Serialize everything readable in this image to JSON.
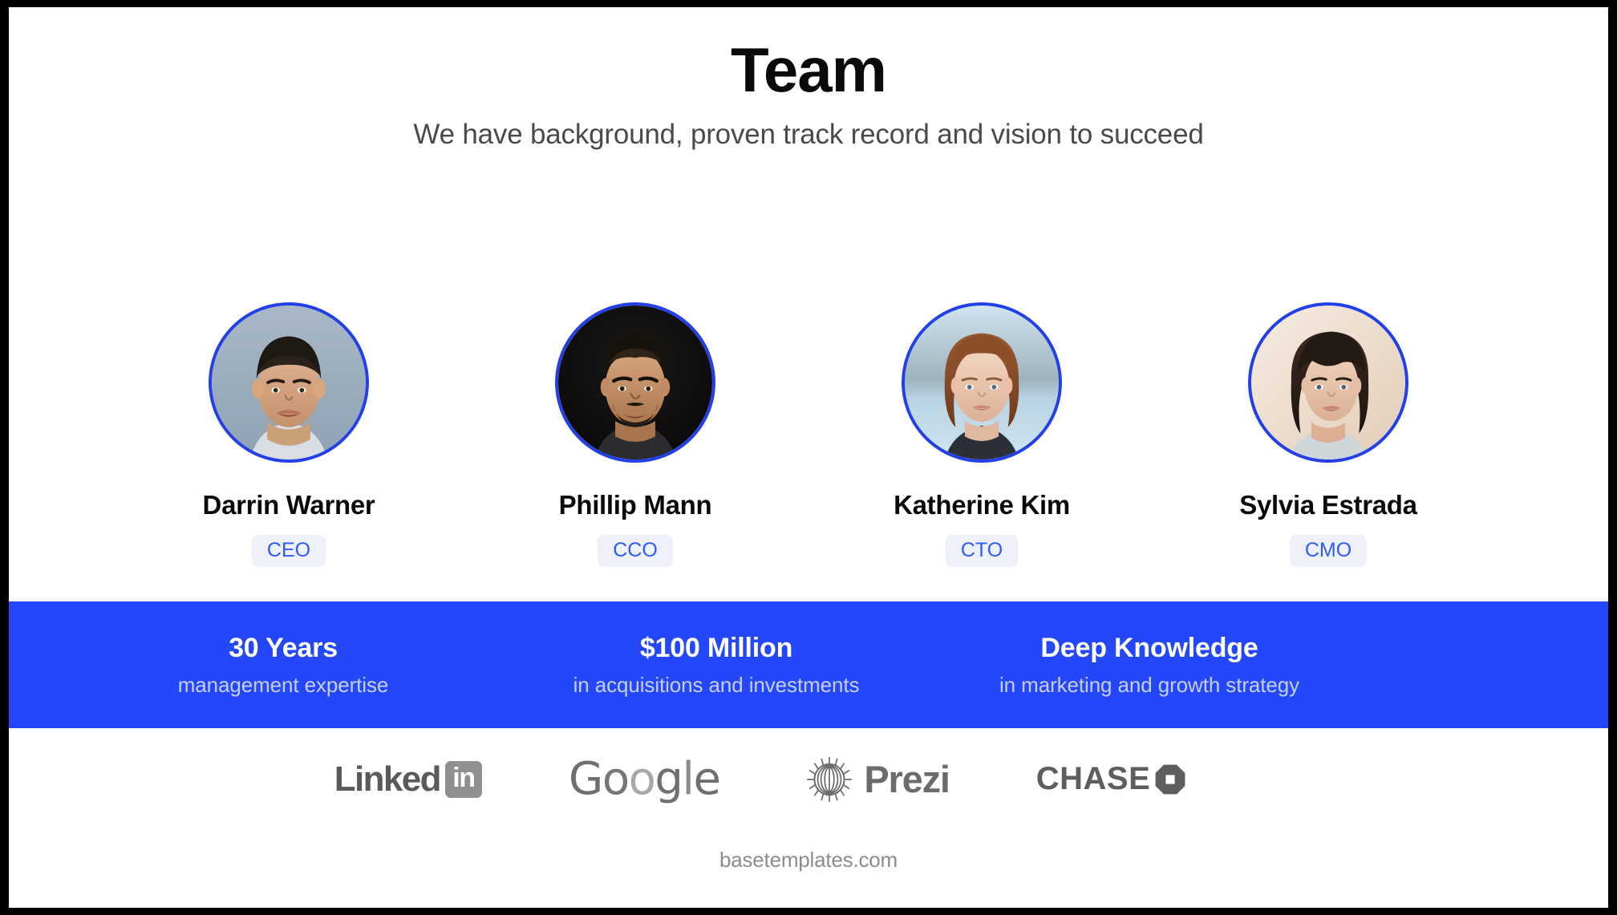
{
  "slide": {
    "title": "Team",
    "subtitle": "We have background, proven track record and vision to succeed"
  },
  "team": {
    "members": [
      {
        "name": "Darrin Warner",
        "role": "CEO",
        "avatar": "portrait-man-dark-hair",
        "avatar_bg": "#9fb0c0"
      },
      {
        "name": "Phillip Mann",
        "role": "CCO",
        "avatar": "portrait-man-beard",
        "avatar_bg": "#0a0a0a"
      },
      {
        "name": "Katherine Kim",
        "role": "CTO",
        "avatar": "portrait-woman-auburn-hair",
        "avatar_bg": "#bcd7e8"
      },
      {
        "name": "Sylvia Estrada",
        "role": "CMO",
        "avatar": "portrait-woman-dark-hair",
        "avatar_bg": "#efe2d6"
      }
    ]
  },
  "stats": {
    "items": [
      {
        "value": "30 Years",
        "label": "management expertise"
      },
      {
        "value": "$100 Million",
        "label": "in acquisitions and investments"
      },
      {
        "value": "Deep Knowledge",
        "label": "in marketing and growth strategy"
      }
    ]
  },
  "logos": {
    "items": [
      {
        "name": "linkedin",
        "word": "Linked",
        "mark": "in"
      },
      {
        "name": "google",
        "letters": [
          "G",
          "o",
          "o",
          "g",
          "l",
          "e"
        ]
      },
      {
        "name": "prezi",
        "word": "Prezi"
      },
      {
        "name": "chase",
        "word": "CHASE"
      }
    ]
  },
  "footer": {
    "text": "basetemplates.com"
  },
  "colors": {
    "accent_blue": "#2447fa",
    "badge_text": "#2f5bf6",
    "badge_bg": "#eef1f9",
    "avatar_ring": "#2340e8",
    "stat_label": "#c5cffd"
  }
}
